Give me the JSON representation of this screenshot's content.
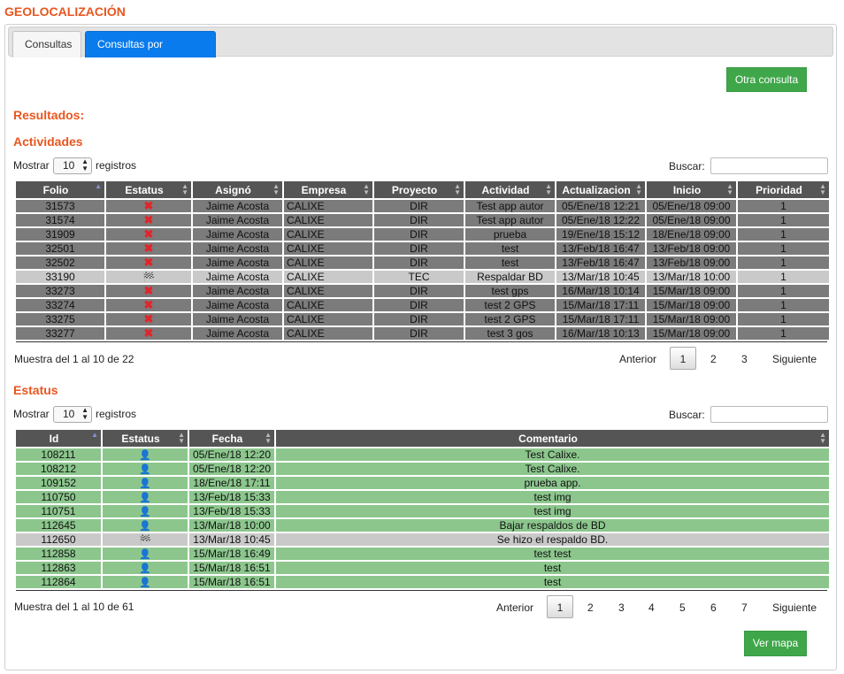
{
  "page_title": "GEOLOCALIZACIÓN",
  "tabs": [
    "Consultas",
    "Consultas por persona"
  ],
  "btn_otra": "Otra consulta",
  "btn_mapa": "Ver mapa",
  "resultados": "Resultados:",
  "actividades": {
    "title": "Actividades",
    "show_pre": "Mostrar",
    "show_val": "10",
    "show_post": "registros",
    "search_label": "Buscar:",
    "headers": [
      "Folio",
      "Estatus",
      "Asignó",
      "Empresa",
      "Proyecto",
      "Actividad",
      "Actualizacion",
      "Inicio",
      "Prioridad"
    ],
    "rows": [
      {
        "folio": "31573",
        "estatus": "x",
        "asigno": "Jaime Acosta",
        "empresa": "CALIXE",
        "proyecto": "DIR",
        "actividad": "Test app autor",
        "act": "05/Ene/18 12:21",
        "inicio": "05/Ene/18 09:00",
        "prioridad": "1"
      },
      {
        "folio": "31574",
        "estatus": "x",
        "asigno": "Jaime Acosta",
        "empresa": "CALIXE",
        "proyecto": "DIR",
        "actividad": "Test app autor",
        "act": "05/Ene/18 12:22",
        "inicio": "05/Ene/18 09:00",
        "prioridad": "1"
      },
      {
        "folio": "31909",
        "estatus": "x",
        "asigno": "Jaime Acosta",
        "empresa": "CALIXE",
        "proyecto": "DIR",
        "actividad": "prueba",
        "act": "19/Ene/18 15:12",
        "inicio": "18/Ene/18 09:00",
        "prioridad": "1"
      },
      {
        "folio": "32501",
        "estatus": "x",
        "asigno": "Jaime Acosta",
        "empresa": "CALIXE",
        "proyecto": "DIR",
        "actividad": "test",
        "act": "13/Feb/18 16:47",
        "inicio": "13/Feb/18 09:00",
        "prioridad": "1"
      },
      {
        "folio": "32502",
        "estatus": "x",
        "asigno": "Jaime Acosta",
        "empresa": "CALIXE",
        "proyecto": "DIR",
        "actividad": "test",
        "act": "13/Feb/18 16:47",
        "inicio": "13/Feb/18 09:00",
        "prioridad": "1"
      },
      {
        "folio": "33190",
        "estatus": "flag",
        "asigno": "Jaime Acosta",
        "empresa": "CALIXE",
        "proyecto": "TEC",
        "actividad": "Respaldar BD",
        "act": "13/Mar/18 10:45",
        "inicio": "13/Mar/18 10:00",
        "prioridad": "1"
      },
      {
        "folio": "33273",
        "estatus": "x",
        "asigno": "Jaime Acosta",
        "empresa": "CALIXE",
        "proyecto": "DIR",
        "actividad": "test gps",
        "act": "16/Mar/18 10:14",
        "inicio": "15/Mar/18 09:00",
        "prioridad": "1"
      },
      {
        "folio": "33274",
        "estatus": "x",
        "asigno": "Jaime Acosta",
        "empresa": "CALIXE",
        "proyecto": "DIR",
        "actividad": "test 2 GPS",
        "act": "15/Mar/18 17:11",
        "inicio": "15/Mar/18 09:00",
        "prioridad": "1"
      },
      {
        "folio": "33275",
        "estatus": "x",
        "asigno": "Jaime Acosta",
        "empresa": "CALIXE",
        "proyecto": "DIR",
        "actividad": "test 2 GPS",
        "act": "15/Mar/18 17:11",
        "inicio": "15/Mar/18 09:00",
        "prioridad": "1"
      },
      {
        "folio": "33277",
        "estatus": "x",
        "asigno": "Jaime Acosta",
        "empresa": "CALIXE",
        "proyecto": "DIR",
        "actividad": "test 3 gos",
        "act": "16/Mar/18 10:13",
        "inicio": "15/Mar/18 09:00",
        "prioridad": "1"
      }
    ],
    "info": "Muestra del 1 al 10 de 22",
    "pager": {
      "prev": "Anterior",
      "pages": [
        "1",
        "2",
        "3"
      ],
      "next": "Siguiente"
    }
  },
  "estatus": {
    "title": "Estatus",
    "show_pre": "Mostrar",
    "show_val": "10",
    "show_post": "registros",
    "search_label": "Buscar:",
    "headers": [
      "Id",
      "Estatus",
      "Fecha",
      "Comentario"
    ],
    "rows": [
      {
        "id": "108211",
        "estatus": "user",
        "fecha": "05/Ene/18 12:20",
        "comentario": "Test Calixe."
      },
      {
        "id": "108212",
        "estatus": "user",
        "fecha": "05/Ene/18 12:20",
        "comentario": "Test Calixe."
      },
      {
        "id": "109152",
        "estatus": "user",
        "fecha": "18/Ene/18 17:11",
        "comentario": "prueba app."
      },
      {
        "id": "110750",
        "estatus": "user",
        "fecha": "13/Feb/18 15:33",
        "comentario": "test img"
      },
      {
        "id": "110751",
        "estatus": "user",
        "fecha": "13/Feb/18 15:33",
        "comentario": "test img"
      },
      {
        "id": "112645",
        "estatus": "user",
        "fecha": "13/Mar/18 10:00",
        "comentario": "Bajar respaldos de BD"
      },
      {
        "id": "112650",
        "estatus": "flag",
        "fecha": "13/Mar/18 10:45",
        "comentario": "Se hizo el respaldo BD."
      },
      {
        "id": "112858",
        "estatus": "user",
        "fecha": "15/Mar/18 16:49",
        "comentario": "test test"
      },
      {
        "id": "112863",
        "estatus": "user",
        "fecha": "15/Mar/18 16:51",
        "comentario": "test"
      },
      {
        "id": "112864",
        "estatus": "user",
        "fecha": "15/Mar/18 16:51",
        "comentario": "test"
      }
    ],
    "info": "Muestra del 1 al 10 de 61",
    "pager": {
      "prev": "Anterior",
      "pages": [
        "1",
        "2",
        "3",
        "4",
        "5",
        "6",
        "7"
      ],
      "next": "Siguiente"
    }
  }
}
